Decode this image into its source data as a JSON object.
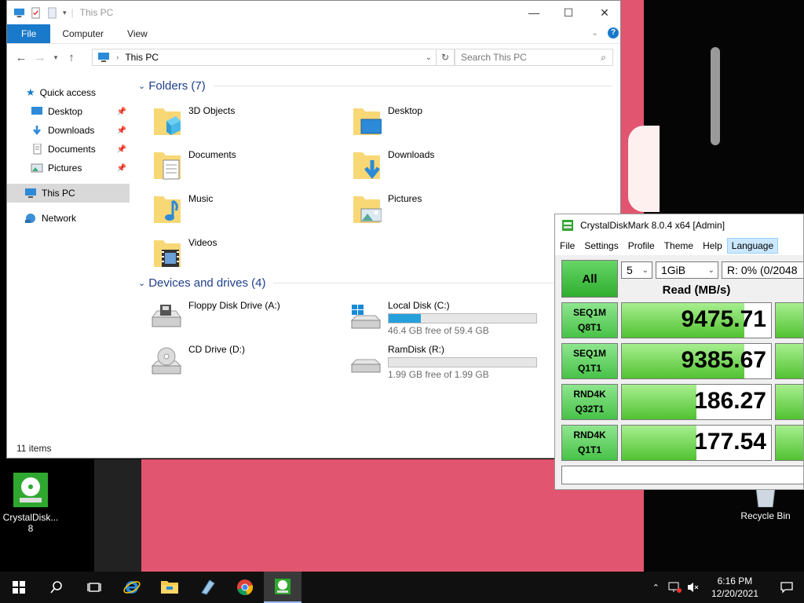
{
  "desktop": {
    "icons": [
      {
        "label": "CrystalDisk...\n8",
        "icon": "crystaldiskmark-icon"
      },
      {
        "label": "Recycle Bin",
        "icon": "recycle-bin-icon"
      }
    ]
  },
  "explorer": {
    "title": "This PC",
    "ribbon_tabs": [
      "File",
      "Computer",
      "View"
    ],
    "address": "This PC",
    "search_placeholder": "Search This PC",
    "nav": {
      "quick_access": "Quick access",
      "items": [
        "Desktop",
        "Downloads",
        "Documents",
        "Pictures"
      ],
      "this_pc": "This PC",
      "network": "Network"
    },
    "folders_header": "Folders (7)",
    "folders": [
      "3D Objects",
      "Desktop",
      "Documents",
      "Downloads",
      "Music",
      "Pictures",
      "Videos"
    ],
    "drives_header": "Devices and drives (4)",
    "drives": [
      {
        "name": "Floppy Disk Drive (A:)",
        "free": "",
        "used_fraction": null
      },
      {
        "name": "Local Disk (C:)",
        "free": "46.4 GB free of 59.4 GB",
        "used_fraction": 0.22
      },
      {
        "name": "CD Drive (D:)",
        "free": "",
        "used_fraction": null
      },
      {
        "name": "RamDisk (R:)",
        "free": "1.99 GB free of 1.99 GB",
        "used_fraction": 0.0
      }
    ],
    "status": "11 items"
  },
  "cdm": {
    "title": "CrystalDiskMark 8.0.4 x64 [Admin]",
    "menu": [
      "File",
      "Settings",
      "Profile",
      "Theme",
      "Help",
      "Language"
    ],
    "all_label": "All",
    "count": "5",
    "size": "1GiB",
    "drive": "R: 0% (0/2048",
    "read_header": "Read (MB/s)",
    "tests": [
      {
        "l1": "SEQ1M",
        "l2": "Q8T1",
        "value": "9475.71",
        "fill": 0.82
      },
      {
        "l1": "SEQ1M",
        "l2": "Q1T1",
        "value": "9385.67",
        "fill": 0.82
      },
      {
        "l1": "RND4K",
        "l2": "Q32T1",
        "value": "186.27",
        "fill": 0.5
      },
      {
        "l1": "RND4K",
        "l2": "Q1T1",
        "value": "177.54",
        "fill": 0.5
      }
    ]
  },
  "taskbar": {
    "time": "6:16 PM",
    "date": "12/20/2021"
  },
  "colors": {
    "accent": "#1979ca",
    "cdm_green": "#48c248",
    "drive_bar": "#26a0da"
  }
}
